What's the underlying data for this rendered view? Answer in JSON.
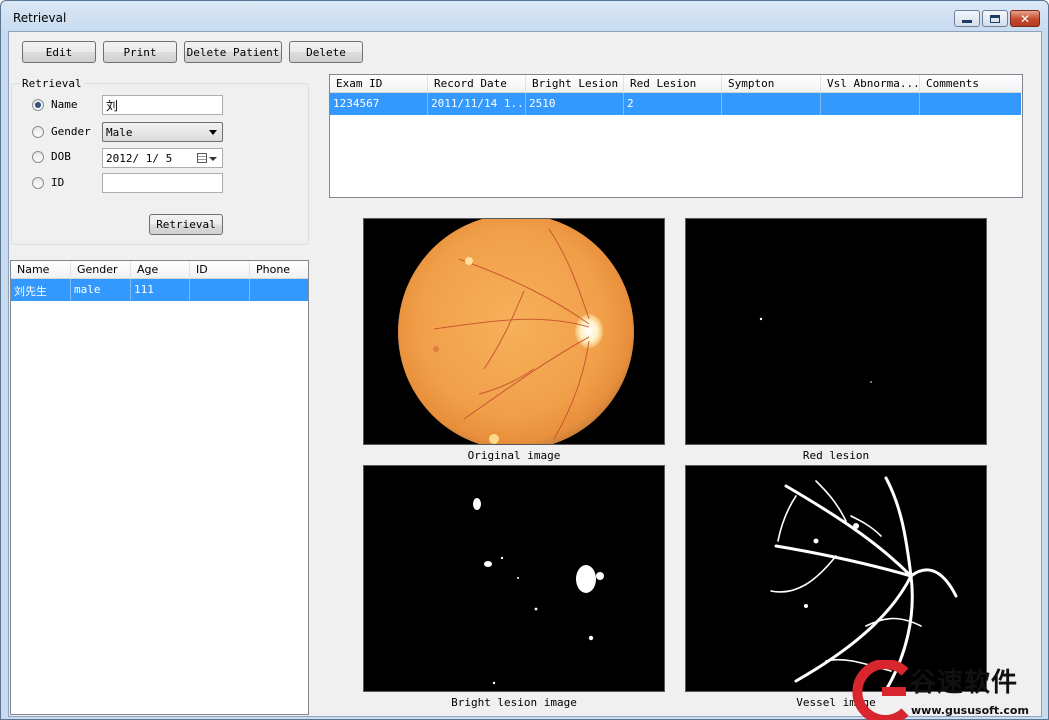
{
  "window": {
    "title": "Retrieval"
  },
  "toolbar": {
    "edit_label": "Edit",
    "print_label": "Print",
    "delete_patient_label": "Delete Patient",
    "delete_label": "Delete"
  },
  "retrieval": {
    "group_label": "Retrieval",
    "name_label": "Name",
    "name_value": "刘",
    "gender_label": "Gender",
    "gender_value": "Male",
    "dob_label": "DOB",
    "dob_value": "2012/ 1/ 5",
    "id_label": "ID",
    "id_value": "",
    "button_label": "Retrieval"
  },
  "patients": {
    "columns": [
      "Name",
      "Gender",
      "Age",
      "ID",
      "Phone"
    ],
    "rows": [
      {
        "name": "刘先生",
        "gender": "male",
        "age": "111",
        "id": "",
        "phone": ""
      }
    ]
  },
  "exams": {
    "columns": [
      "Exam ID",
      "Record Date",
      "Bright Lesion",
      "Red Lesion",
      "Sympton",
      "Vsl Abnorma...",
      "Comments"
    ],
    "rows": [
      {
        "exam_id": "1234567",
        "record_date": "2011/11/14 1...",
        "bright_lesion": "2510",
        "red_lesion": "2",
        "sympton": "",
        "vsl": "",
        "comments": ""
      }
    ]
  },
  "images": {
    "original_caption": "Original image",
    "red_caption": "Red lesion",
    "bright_caption": "Bright lesion image",
    "vessel_caption": "Vessel image"
  },
  "watermark": {
    "brand": "谷速软件",
    "url": "www.gususoft.com"
  }
}
